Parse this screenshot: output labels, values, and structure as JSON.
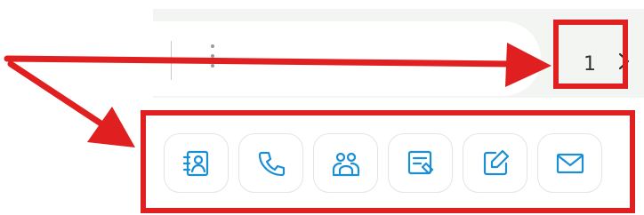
{
  "pagination": {
    "page_number": "1"
  },
  "toolbar": {
    "actions": [
      {
        "name": "contact-card-button",
        "icon": "contact-card-icon"
      },
      {
        "name": "call-button",
        "icon": "phone-icon"
      },
      {
        "name": "team-button",
        "icon": "users-icon"
      },
      {
        "name": "form-button",
        "icon": "form-edit-icon"
      },
      {
        "name": "edit-button",
        "icon": "edit-icon"
      },
      {
        "name": "email-button",
        "icon": "mail-icon"
      }
    ]
  },
  "colors": {
    "accent_icon": "#1a8fd6",
    "annotation_red": "#e02020",
    "strip_bg": "#f3f5f3"
  }
}
